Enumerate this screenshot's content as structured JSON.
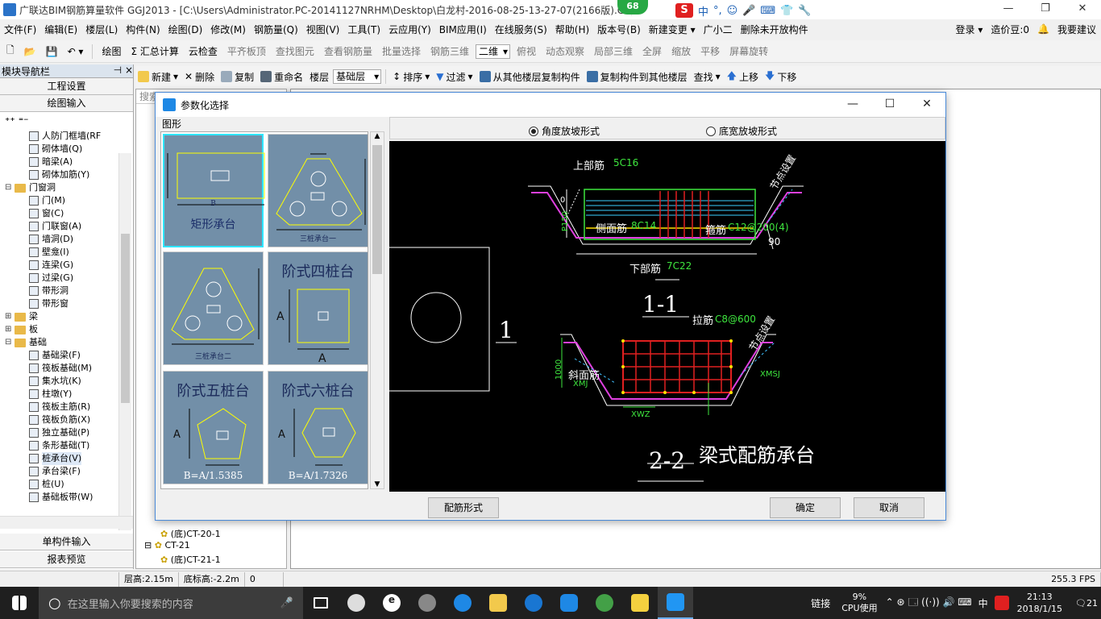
{
  "titlebar": {
    "title": "广联达BIM钢筋算量软件 GGJ2013 - [C:\\Users\\Administrator.PC-20141127NRHM\\Desktop\\白龙村-2016-08-25-13-27-07(2166版).GGJ12]",
    "badge": "68",
    "ime_cn": "中"
  },
  "menubar": {
    "items": [
      "文件(F)",
      "编辑(E)",
      "楼层(L)",
      "构件(N)",
      "绘图(D)",
      "修改(M)",
      "钢筋量(Q)",
      "视图(V)",
      "工具(T)",
      "云应用(Y)",
      "BIM应用(I)",
      "在线服务(S)",
      "帮助(H)",
      "版本号(B)",
      "新建变更 ▾",
      "广小二",
      "删除未开放构件"
    ],
    "login": "登录 ▾",
    "price": "造价豆:0",
    "suggest": "我要建议"
  },
  "toolbar1": {
    "items": [
      "绘图",
      "Σ 汇总计算",
      "云检查",
      "平齐板顶",
      "查找图元",
      "查看钢筋量",
      "批量选择",
      "钢筋三维",
      "二维",
      "俯视",
      "动态观察",
      "局部三维",
      "全屏",
      "缩放",
      "平移",
      "屏幕旋转"
    ]
  },
  "nav": {
    "title": "模块导航栏",
    "pin": "⊣ ×",
    "btn_project": "工程设置",
    "btn_draw": "绘图输入",
    "btn_single": "单构件输入",
    "btn_report": "报表预览",
    "tree": [
      {
        "label": "人防门框墙(RF",
        "lvl": 3
      },
      {
        "label": "砌体墙(Q)",
        "lvl": 3
      },
      {
        "label": "暗梁(A)",
        "lvl": 3
      },
      {
        "label": "砌体加筋(Y)",
        "lvl": 3
      },
      {
        "label": "门窗洞",
        "lvl": 1,
        "folder": true,
        "exp": "⊟"
      },
      {
        "label": "门(M)",
        "lvl": 3
      },
      {
        "label": "窗(C)",
        "lvl": 3
      },
      {
        "label": "门联窗(A)",
        "lvl": 3
      },
      {
        "label": "墙洞(D)",
        "lvl": 3
      },
      {
        "label": "壁龛(I)",
        "lvl": 3
      },
      {
        "label": "连梁(G)",
        "lvl": 3
      },
      {
        "label": "过梁(G)",
        "lvl": 3
      },
      {
        "label": "带形洞",
        "lvl": 3
      },
      {
        "label": "带形窗",
        "lvl": 3
      },
      {
        "label": "梁",
        "lvl": 1,
        "folder": true,
        "exp": "⊞"
      },
      {
        "label": "板",
        "lvl": 1,
        "folder": true,
        "exp": "⊞"
      },
      {
        "label": "基础",
        "lvl": 1,
        "folder": true,
        "exp": "⊟"
      },
      {
        "label": "基础梁(F)",
        "lvl": 3
      },
      {
        "label": "筏板基础(M)",
        "lvl": 3
      },
      {
        "label": "集水坑(K)",
        "lvl": 3
      },
      {
        "label": "柱墩(Y)",
        "lvl": 3
      },
      {
        "label": "筏板主筋(R)",
        "lvl": 3
      },
      {
        "label": "筏板负筋(X)",
        "lvl": 3
      },
      {
        "label": "独立基础(P)",
        "lvl": 3
      },
      {
        "label": "条形基础(T)",
        "lvl": 3
      },
      {
        "label": "桩承台(V)",
        "lvl": 3,
        "selected": true
      },
      {
        "label": "承台梁(F)",
        "lvl": 3
      },
      {
        "label": "桩(U)",
        "lvl": 3
      },
      {
        "label": "基础板带(W)",
        "lvl": 3
      }
    ]
  },
  "toolbar2": {
    "new": "新建",
    "delete": "删除",
    "copy": "复制",
    "rename": "重命名",
    "floor": "楼层",
    "floor_val": "基础层",
    "sort": "排序",
    "filter": "过滤",
    "copy_from": "从其他楼层复制构件",
    "copy_to": "复制构件到其他楼层",
    "find": "查找",
    "up": "上移",
    "down": "下移"
  },
  "leftpane2": {
    "search": "搜索",
    "rows": [
      "(底)CT-20-1",
      "CT-21",
      "(底)CT-21-1"
    ]
  },
  "status": {
    "floor_h": "层高:2.15m",
    "bottom_h": "底标高:-2.2m",
    "zero": "0",
    "fps": "255.3 FPS"
  },
  "dialog": {
    "title": "参数化选择",
    "group": "图形",
    "radio1": "角度放坡形式",
    "radio2": "底宽放坡形式",
    "btn_rebar": "配筋形式",
    "btn_ok": "确定",
    "btn_cancel": "取消",
    "thumbs": [
      {
        "label": "矩形承台"
      },
      {
        "label": "三桩承台一"
      },
      {
        "label": "三桩承台二"
      },
      {
        "label": "阶式四桩台"
      },
      {
        "label": "阶式五桩台",
        "formula": "B=A/1.5385"
      },
      {
        "label": "阶式六桩台",
        "formula": "B=A/1.7326"
      }
    ],
    "preview": {
      "top_rebar": "上部筋",
      "top_rebar_v": "5C16",
      "side_rebar": "侧面筋",
      "side_rebar_v": "8C14",
      "stirrup": "箍筋",
      "stirrup_v": "C12@200(4)",
      "bottom_rebar": "下部筋",
      "bottom_rebar_v": "7C22",
      "node": "节点设置",
      "sec1": "1-1",
      "sec2": "2-2",
      "num1": "1",
      "angle": "90",
      "tie": "拉筋",
      "tie_v": "C8@600",
      "slope": "斜面筋",
      "xmj": "XMJ",
      "xmsj": "XMSJ",
      "xwz": "XWZ",
      "dim1000": "1000",
      "p150": "P150",
      "zero": "0",
      "caption": "梁式配筋承台"
    }
  },
  "taskbar": {
    "search": "在这里输入你要搜索的内容",
    "link": "链接",
    "cpu_pct": "9%",
    "cpu": "CPU使用",
    "ime": "中",
    "time": "21:13",
    "date": "2018/1/15",
    "notif": "21"
  }
}
